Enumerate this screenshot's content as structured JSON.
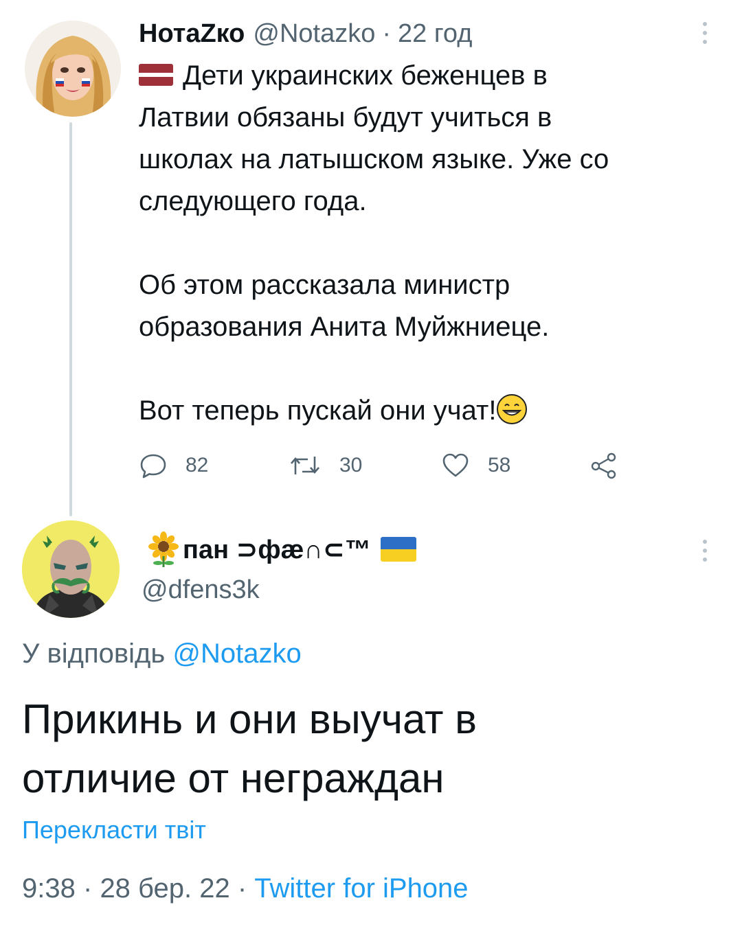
{
  "tweet1": {
    "author_name": "НотаZко",
    "author_handle": "@Notazko",
    "separator": "·",
    "time": "22 год",
    "flag": "latvia-flag",
    "lines": [
      "Дети украинских беженцев в",
      "Латвии обязаны будут учиться в",
      "школах на латышском языке. Уже со",
      "следующего года.",
      "",
      "Об этом рассказала министр",
      "образования Анита Муйжниеце.",
      "",
      "Вот теперь пускай они учат!"
    ],
    "actions": {
      "replies": "82",
      "retweets": "30",
      "likes": "58"
    }
  },
  "tweet2": {
    "author_name": "пан ⊃фæ∩⊂™",
    "author_handle": "@dfens3k",
    "reply_prefix": "У відповідь",
    "reply_mention": "@Notazko",
    "lines": [
      "Прикинь и они выучат в",
      "отличие от неграждан"
    ],
    "translate_label": "Перекласти твіт",
    "time": "9:38",
    "date": "28 бер. 22",
    "separator": "·",
    "source": "Twitter for iPhone"
  },
  "colors": {
    "text": "#0f1419",
    "secondary": "#536471",
    "link": "#1d9bf0",
    "thread_line": "#cfd9de"
  }
}
